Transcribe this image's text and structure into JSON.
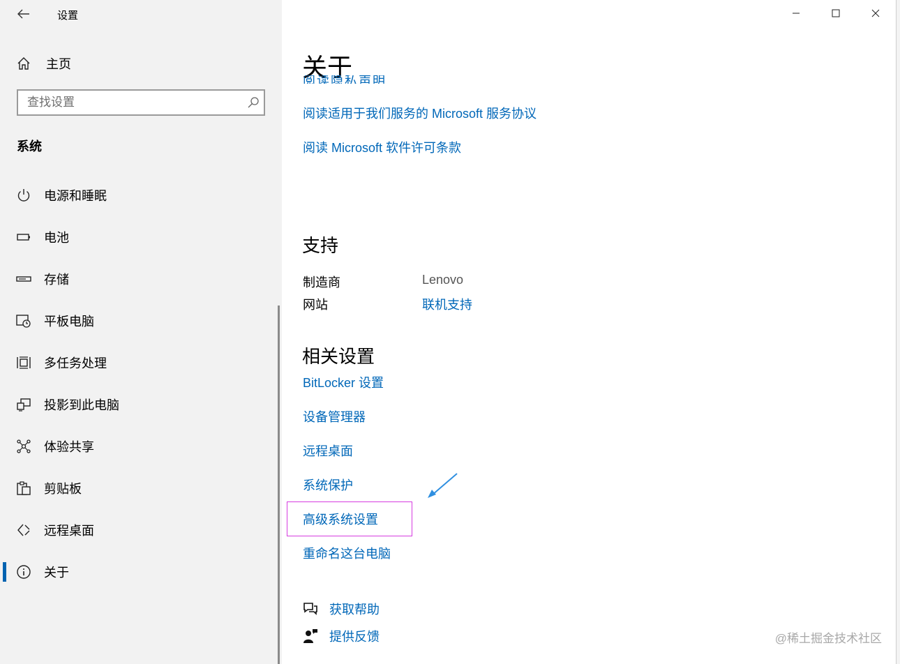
{
  "app": {
    "title": "设置"
  },
  "window_controls": {
    "minimize": "minimize-icon",
    "maximize": "maximize-icon",
    "close": "close-icon"
  },
  "sidebar": {
    "home_label": "主页",
    "search_placeholder": "查找设置",
    "section": "系统",
    "items": [
      {
        "label": "电源和睡眠",
        "icon": "power-icon"
      },
      {
        "label": "电池",
        "icon": "battery-icon"
      },
      {
        "label": "存储",
        "icon": "storage-icon"
      },
      {
        "label": "平板电脑",
        "icon": "tablet-icon"
      },
      {
        "label": "多任务处理",
        "icon": "multitasking-icon"
      },
      {
        "label": "投影到此电脑",
        "icon": "projecting-icon"
      },
      {
        "label": "体验共享",
        "icon": "shared-experiences-icon"
      },
      {
        "label": "剪贴板",
        "icon": "clipboard-icon"
      },
      {
        "label": "远程桌面",
        "icon": "remote-desktop-icon"
      },
      {
        "label": "关于",
        "icon": "info-icon",
        "active": true
      }
    ]
  },
  "main": {
    "title": "关于",
    "cut_text": "阅读隐私声明",
    "legal_links": [
      "阅读适用于我们服务的 Microsoft 服务协议",
      "阅读 Microsoft 软件许可条款"
    ],
    "support": {
      "heading": "支持",
      "manufacturer_label": "制造商",
      "manufacturer_value": "Lenovo",
      "website_label": "网站",
      "website_link": "联机支持"
    },
    "related": {
      "heading": "相关设置",
      "links": [
        "BitLocker 设置",
        "设备管理器",
        "远程桌面",
        "系统保护",
        "高级系统设置",
        "重命名这台电脑"
      ]
    },
    "help": {
      "get_help": "获取帮助",
      "feedback": "提供反馈"
    }
  },
  "colors": {
    "link": "#0067b8",
    "accent": "#0063b1",
    "highlight": "#d63be0",
    "annotation_arrow": "#2f8fe0"
  },
  "watermark": "@稀土掘金技术社区"
}
